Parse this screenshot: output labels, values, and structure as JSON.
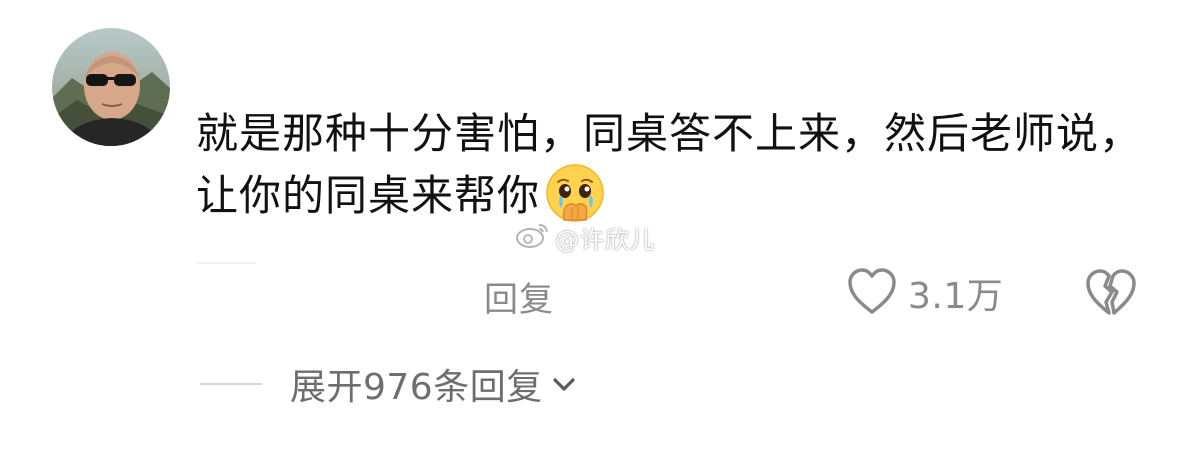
{
  "comment": {
    "text": "就是那种十分害怕，同桌答不上来，然后老师说，让你的同桌来帮你",
    "emoji": "pleading-face-with-hand-over-mouth"
  },
  "watermark": {
    "text": "@许欣儿"
  },
  "actions": {
    "reply_label": "回复",
    "like_count": "3.1万",
    "expand_label": "展开976条回复"
  },
  "icons": {
    "like": "heart-outline-icon",
    "dislike": "broken-heart-icon",
    "expand": "chevron-down-icon",
    "watermark_logo": "weibo-logo-icon"
  },
  "colors": {
    "text": "#111111",
    "secondary": "#8a8a8a",
    "background": "#ffffff"
  }
}
